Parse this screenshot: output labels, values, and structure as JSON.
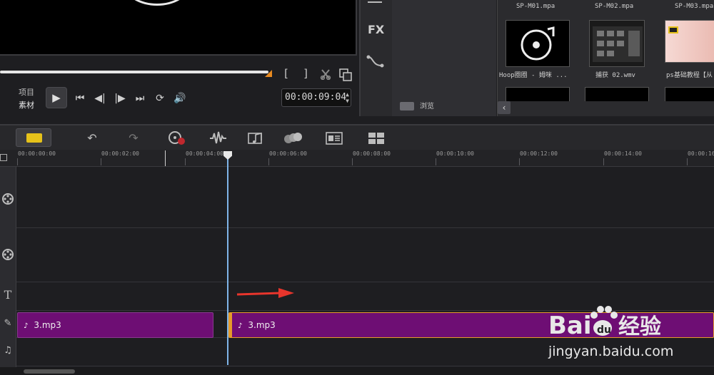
{
  "player": {
    "mode_project": "项目",
    "mode_clip": "素材",
    "mark_in": "[",
    "mark_out": "]",
    "timecode": "00:00:09:04",
    "scrub_progress": 0.75
  },
  "library": {
    "fx_label": "FX",
    "browse_label": "浏览",
    "items": [
      {
        "caption": "SP-M01.mpa"
      },
      {
        "caption": "SP-M02.mpa"
      },
      {
        "caption": "SP-M03.mpa"
      },
      {
        "caption": "Hoop圈圈 - 姆咪 ..."
      },
      {
        "caption": "捕获 02.wmv"
      },
      {
        "caption": "ps基础教程【从"
      }
    ]
  },
  "ruler": {
    "ticks": [
      "00:00:00:00",
      "00:00:02:00",
      "00:00:04:00",
      "00:00:06:00",
      "00:00:08:00",
      "00:00:10:00",
      "00:00:12:00",
      "00:00:14:00",
      "00:00:16"
    ]
  },
  "tracks": {
    "music_clips": [
      {
        "name": "3.mp3"
      },
      {
        "name": "3.mp3"
      }
    ]
  },
  "watermark": {
    "url": "jingyan.baidu.com"
  },
  "colors": {
    "clip": "#6e0e74",
    "accent": "#e6c21a",
    "playhead": "#7fb4e8",
    "arrow": "#e8352c"
  }
}
